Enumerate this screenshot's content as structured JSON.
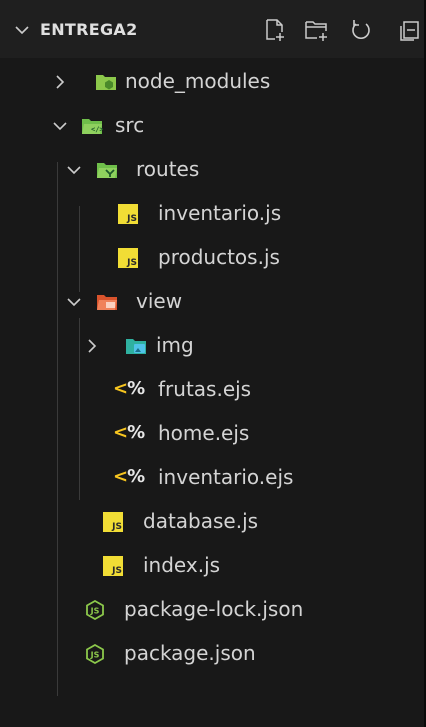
{
  "explorer": {
    "title": "ENTREGA2",
    "actions": [
      {
        "name": "new-file-icon"
      },
      {
        "name": "new-folder-icon"
      },
      {
        "name": "refresh-icon"
      },
      {
        "name": "collapse-all-icon"
      }
    ]
  },
  "tree": {
    "items": [
      {
        "label": "node_modules",
        "kind": "folder",
        "icon": "node-folder-icon",
        "expanded": false
      },
      {
        "label": "src",
        "kind": "folder",
        "icon": "src-folder-icon",
        "expanded": true
      },
      {
        "label": "routes",
        "kind": "folder",
        "icon": "routes-folder-icon",
        "expanded": true
      },
      {
        "label": "inventario.js",
        "kind": "file",
        "icon": "js-file-icon",
        "icon_text": "JS"
      },
      {
        "label": "productos.js",
        "kind": "file",
        "icon": "js-file-icon",
        "icon_text": "JS"
      },
      {
        "label": "view",
        "kind": "folder",
        "icon": "view-folder-icon",
        "expanded": true
      },
      {
        "label": "img",
        "kind": "folder",
        "icon": "img-folder-icon",
        "expanded": false
      },
      {
        "label": "frutas.ejs",
        "kind": "file",
        "icon": "ejs-file-icon",
        "icon_text": "<%"
      },
      {
        "label": "home.ejs",
        "kind": "file",
        "icon": "ejs-file-icon",
        "icon_text": "<%"
      },
      {
        "label": "inventario.ejs",
        "kind": "file",
        "icon": "ejs-file-icon",
        "icon_text": "<%"
      },
      {
        "label": "database.js",
        "kind": "file",
        "icon": "js-file-icon",
        "icon_text": "JS"
      },
      {
        "label": "index.js",
        "kind": "file",
        "icon": "js-file-icon",
        "icon_text": "JS"
      },
      {
        "label": "package-lock.json",
        "kind": "file",
        "icon": "node-json-icon"
      },
      {
        "label": "package.json",
        "kind": "file",
        "icon": "node-json-icon"
      }
    ]
  },
  "colors": {
    "background": "#181818",
    "header_background": "#1f1f1f",
    "text": "#d4d4d4",
    "js_badge": "#f1dd35",
    "ejs_icon": "#f7c51f",
    "node_green": "#8cc84b",
    "folder_green": "#6fbf4a",
    "view_folder": "#e8663d",
    "img_folder": "#2fb1a0"
  }
}
